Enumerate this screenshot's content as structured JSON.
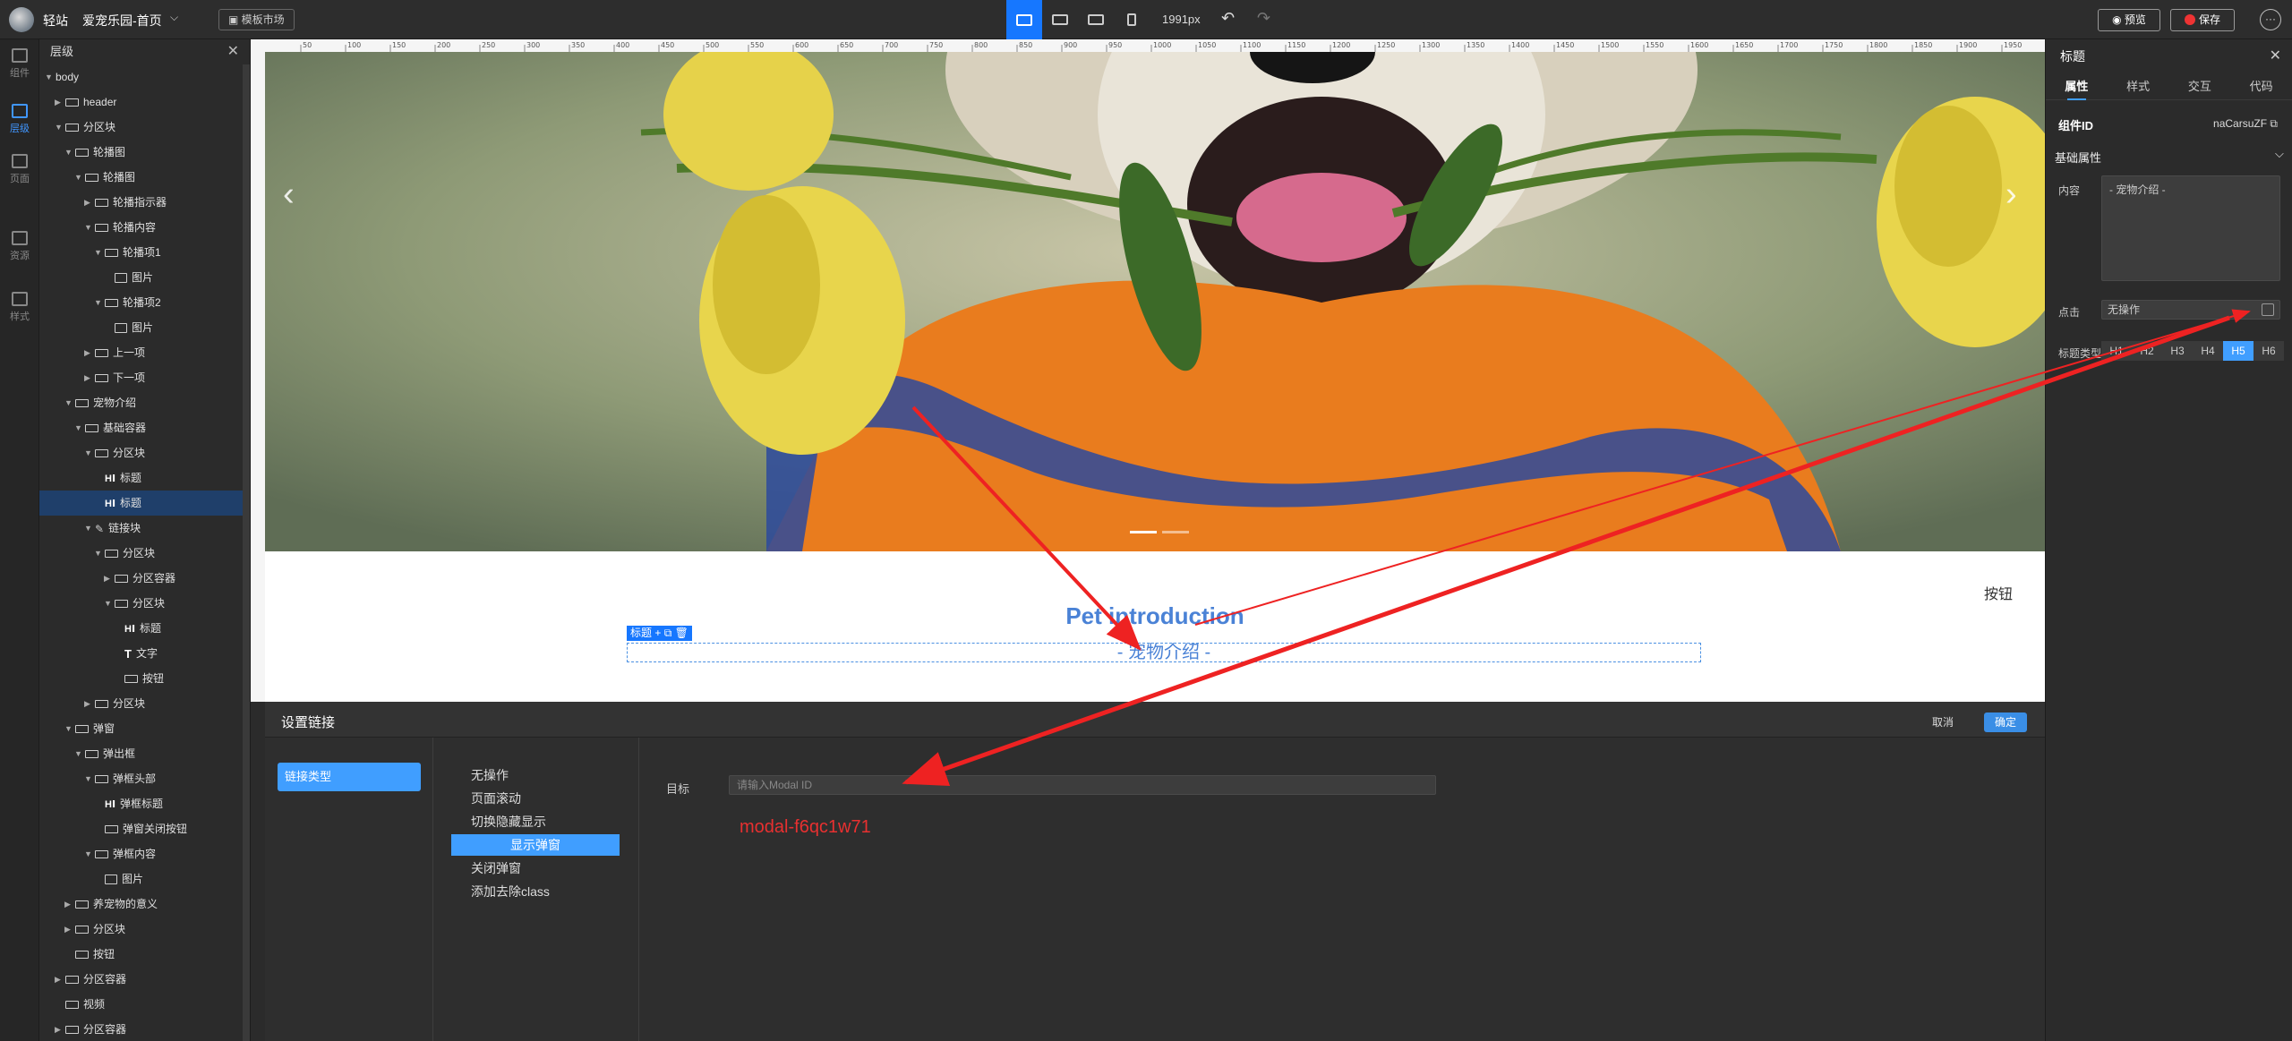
{
  "topbar": {
    "app_name": "轻站",
    "project_name": "爱宠乐园-首页",
    "template_market": "模板市场",
    "width_label": "1991px",
    "preview": "预览",
    "save": "保存",
    "more": "···"
  },
  "leftrail": {
    "items": [
      {
        "label": "组件",
        "icon": "components-icon"
      },
      {
        "label": "层级",
        "icon": "layers-icon",
        "active": true
      },
      {
        "label": "页面",
        "icon": "pages-icon"
      },
      {
        "label": "资源",
        "icon": "assets-icon"
      },
      {
        "label": "样式",
        "icon": "style-icon"
      }
    ]
  },
  "layers": {
    "title": "层级",
    "tree": [
      {
        "label": "body",
        "depth": 0,
        "icon": "none",
        "twisty": "open"
      },
      {
        "label": "header",
        "depth": 1,
        "icon": "box",
        "twisty": "closed"
      },
      {
        "label": "分区块",
        "depth": 1,
        "icon": "box",
        "twisty": "open"
      },
      {
        "label": "轮播图",
        "depth": 2,
        "icon": "box",
        "twisty": "open"
      },
      {
        "label": "轮播图",
        "depth": 3,
        "icon": "box",
        "twisty": "open"
      },
      {
        "label": "轮播指示器",
        "depth": 4,
        "icon": "box",
        "twisty": "closed"
      },
      {
        "label": "轮播内容",
        "depth": 4,
        "icon": "box",
        "twisty": "open"
      },
      {
        "label": "轮播项1",
        "depth": 5,
        "icon": "box",
        "twisty": "open"
      },
      {
        "label": "图片",
        "depth": 6,
        "icon": "img",
        "twisty": "none"
      },
      {
        "label": "轮播项2",
        "depth": 5,
        "icon": "box",
        "twisty": "open"
      },
      {
        "label": "图片",
        "depth": 6,
        "icon": "img",
        "twisty": "none"
      },
      {
        "label": "上一项",
        "depth": 4,
        "icon": "box",
        "twisty": "closed"
      },
      {
        "label": "下一项",
        "depth": 4,
        "icon": "box",
        "twisty": "closed"
      },
      {
        "label": "宠物介绍",
        "depth": 2,
        "icon": "box",
        "twisty": "open"
      },
      {
        "label": "基础容器",
        "depth": 3,
        "icon": "box",
        "twisty": "open"
      },
      {
        "label": "分区块",
        "depth": 4,
        "icon": "box",
        "twisty": "open"
      },
      {
        "label": "标题",
        "depth": 5,
        "icon": "h",
        "twisty": "none"
      },
      {
        "label": "标题",
        "depth": 5,
        "icon": "h",
        "twisty": "none",
        "selected": true
      },
      {
        "label": "链接块",
        "depth": 4,
        "icon": "link",
        "twisty": "open"
      },
      {
        "label": "分区块",
        "depth": 5,
        "icon": "box",
        "twisty": "open"
      },
      {
        "label": "分区容器",
        "depth": 6,
        "icon": "box",
        "twisty": "closed"
      },
      {
        "label": "分区块",
        "depth": 6,
        "icon": "box",
        "twisty": "open"
      },
      {
        "label": "标题",
        "depth": 7,
        "icon": "h",
        "twisty": "none"
      },
      {
        "label": "文字",
        "depth": 7,
        "icon": "t",
        "twisty": "none"
      },
      {
        "label": "按钮",
        "depth": 7,
        "icon": "box",
        "twisty": "none"
      },
      {
        "label": "分区块",
        "depth": 4,
        "icon": "box",
        "twisty": "closed"
      },
      {
        "label": "弹窗",
        "depth": 2,
        "icon": "box",
        "twisty": "open"
      },
      {
        "label": "弹出框",
        "depth": 3,
        "icon": "box",
        "twisty": "open"
      },
      {
        "label": "弹框头部",
        "depth": 4,
        "icon": "box",
        "twisty": "open"
      },
      {
        "label": "弹框标题",
        "depth": 5,
        "icon": "h",
        "twisty": "none"
      },
      {
        "label": "弹窗关闭按钮",
        "depth": 5,
        "icon": "box",
        "twisty": "none"
      },
      {
        "label": "弹框内容",
        "depth": 4,
        "icon": "box",
        "twisty": "open"
      },
      {
        "label": "图片",
        "depth": 5,
        "icon": "img",
        "twisty": "none"
      },
      {
        "label": "养宠物的意义",
        "depth": 2,
        "icon": "box",
        "twisty": "closed"
      },
      {
        "label": "分区块",
        "depth": 2,
        "icon": "box",
        "twisty": "closed"
      },
      {
        "label": "按钮",
        "depth": 2,
        "icon": "box",
        "twisty": "none"
      },
      {
        "label": "分区容器",
        "depth": 1,
        "icon": "box",
        "twisty": "closed"
      },
      {
        "label": "视频",
        "depth": 1,
        "icon": "box",
        "twisty": "none"
      },
      {
        "label": "分区容器",
        "depth": 1,
        "icon": "box",
        "twisty": "closed"
      }
    ]
  },
  "ruler": {
    "ticks": [
      "50",
      "100",
      "150",
      "200",
      "250",
      "300",
      "350",
      "400",
      "450",
      "500",
      "550",
      "600",
      "650",
      "700",
      "750",
      "800",
      "850",
      "900",
      "950",
      "1000",
      "1050",
      "1100",
      "1150",
      "1200",
      "1250",
      "1300",
      "1350",
      "1400",
      "1450",
      "1500",
      "1550",
      "1600",
      "1650",
      "1700",
      "1750",
      "1800",
      "1850",
      "1900",
      "1950"
    ]
  },
  "canvas": {
    "title_en": "Pet introduction",
    "subtitle": "- 宠物介绍 -",
    "button": "按钮",
    "sel_tag": "标题",
    "carousel_indicator": {
      "count": 2,
      "active": 0
    }
  },
  "dialog": {
    "title": "设置链接",
    "cancel": "取消",
    "ok": "确定",
    "tab": "链接类型",
    "options": [
      "无操作",
      "页面滚动",
      "切换隐藏显示",
      "显示弹窗",
      "关闭弹窗",
      "添加去除class"
    ],
    "selected_option": "显示弹窗",
    "target_label": "目标",
    "target_placeholder": "请输入Modal ID",
    "annotation": "modal-f6qc1w71"
  },
  "rightpanel": {
    "title": "标题",
    "tabs": [
      "属性",
      "样式",
      "交互",
      "代码"
    ],
    "active_tab": "属性",
    "component_id_label": "组件ID",
    "component_id": "naCarsuZF",
    "section": "基础属性",
    "content_label": "内容",
    "content_value": "- 宠物介绍 -",
    "click_label": "点击",
    "click_value": "无操作",
    "heading_type_label": "标题类型",
    "heading_levels": [
      "H1",
      "H2",
      "H3",
      "H4",
      "H5",
      "H6"
    ],
    "heading_active": "H5"
  },
  "colors": {
    "accent": "#409eff",
    "annotation_red": "#e83030",
    "title_blue": "#4a82d6"
  }
}
